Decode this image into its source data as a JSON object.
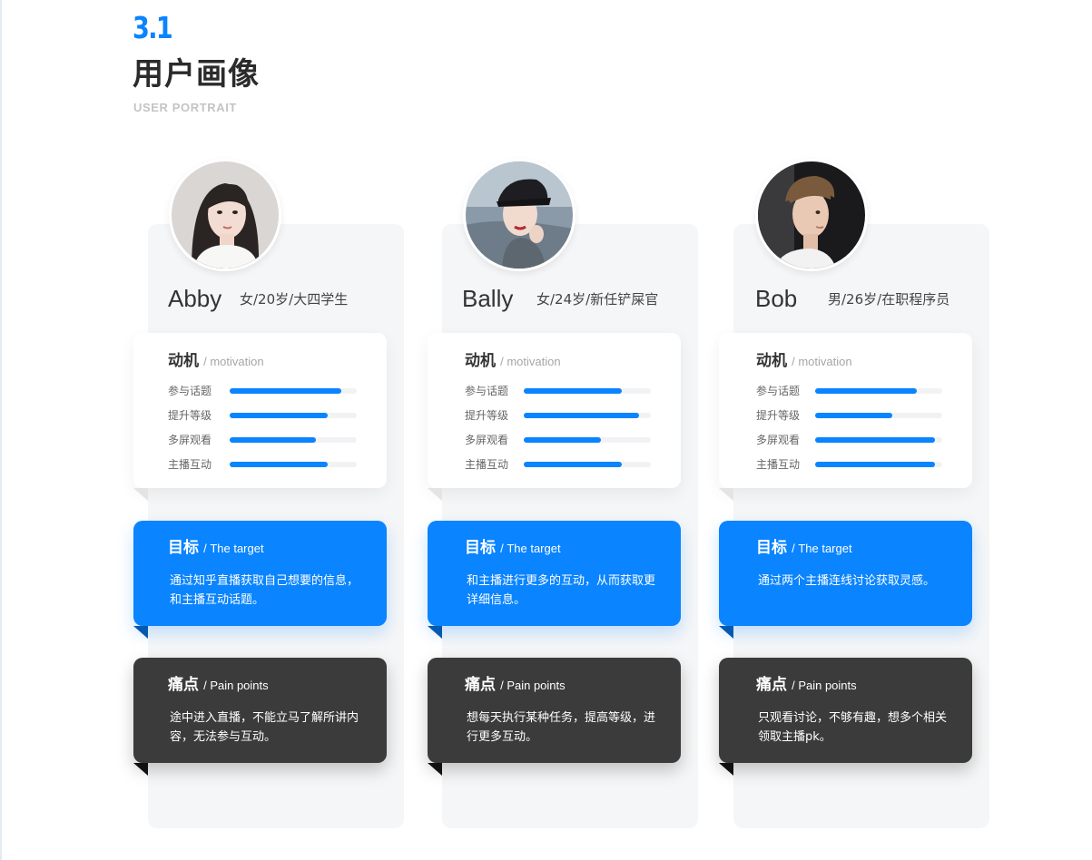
{
  "header": {
    "section_number": "3.1",
    "title": "用户画像",
    "subtitle": "USER PORTRAIT"
  },
  "colors": {
    "accent": "#0a84ff",
    "dark_card": "#3b3b3b",
    "column_bg": "#f5f6f7"
  },
  "personas": [
    {
      "name": "Abby",
      "description": "女/20岁/大四学生",
      "motivation": {
        "title": "动机",
        "subtitle": "/ motivation",
        "items": [
          {
            "label": "参与话题",
            "level": 0.88
          },
          {
            "label": "提升等级",
            "level": 0.77
          },
          {
            "label": "多屏观看",
            "level": 0.68
          },
          {
            "label": "主播互动",
            "level": 0.77
          }
        ]
      },
      "target": {
        "title": "目标",
        "subtitle": "/ The target",
        "text": "通过知乎直播获取自己想要的信息，和主播互动话题。"
      },
      "pain": {
        "title": "痛点",
        "subtitle": "/ Pain points",
        "text": "途中进入直播，不能立马了解所讲内容，无法参与互动。"
      }
    },
    {
      "name": "Bally",
      "description": "女/24岁/新任铲屎官",
      "motivation": {
        "title": "动机",
        "subtitle": "/ motivation",
        "items": [
          {
            "label": "参与话题",
            "level": 0.77
          },
          {
            "label": "提升等级",
            "level": 0.91
          },
          {
            "label": "多屏观看",
            "level": 0.61
          },
          {
            "label": "主播互动",
            "level": 0.77
          }
        ]
      },
      "target": {
        "title": "目标",
        "subtitle": "/ The target",
        "text": "和主播进行更多的互动，从而获取更详细信息。"
      },
      "pain": {
        "title": "痛点",
        "subtitle": "/ Pain points",
        "text": "想每天执行某种任务，提高等级，进行更多互动。"
      }
    },
    {
      "name": "Bob",
      "description": "男/26岁/在职程序员",
      "motivation": {
        "title": "动机",
        "subtitle": "/ motivation",
        "items": [
          {
            "label": "参与话题",
            "level": 0.8
          },
          {
            "label": "提升等级",
            "level": 0.61
          },
          {
            "label": "多屏观看",
            "level": 0.94
          },
          {
            "label": "主播互动",
            "level": 0.94
          }
        ]
      },
      "target": {
        "title": "目标",
        "subtitle": "/ The target",
        "text": "通过两个主播连线讨论获取灵感。"
      },
      "pain": {
        "title": "痛点",
        "subtitle": "/ Pain points",
        "text": "只观看讨论，不够有趣，想多个相关领取主播pk。"
      }
    }
  ]
}
